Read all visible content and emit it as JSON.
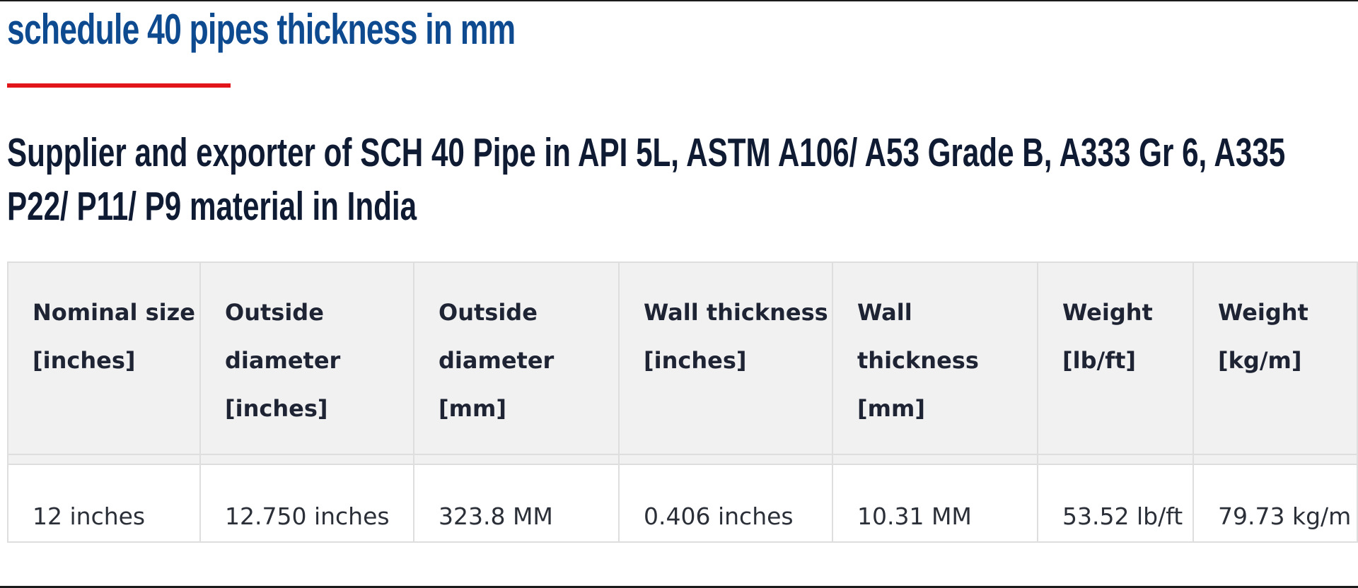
{
  "page": {
    "title": "schedule 40 pipes thickness in mm",
    "subtitle": "Supplier and exporter of SCH 40 Pipe in API 5L, ASTM A106/ A53 Grade B, A333 Gr 6, A335 P22/ P11/ P9 material in India"
  },
  "colors": {
    "title": "#0d4a8f",
    "accent_rule": "#e2151b",
    "heading_text": "#0f1a33",
    "table_header_bg": "#f1f1f1",
    "table_border": "#dedede"
  },
  "table": {
    "headers": [
      "Nominal size [inches]",
      "Outside diameter [inches]",
      "Outside diameter [mm]",
      "Wall thickness [inches]",
      "Wall thickness [mm]",
      "Weight [lb/ft]",
      "Weight [kg/m]"
    ],
    "rows": [
      {
        "cells": [
          "12 inches",
          "12.750 inches",
          "323.8 MM",
          "0.406 inches",
          "10.31 MM",
          "53.52 lb/ft",
          "79.73 kg/m"
        ]
      }
    ]
  }
}
